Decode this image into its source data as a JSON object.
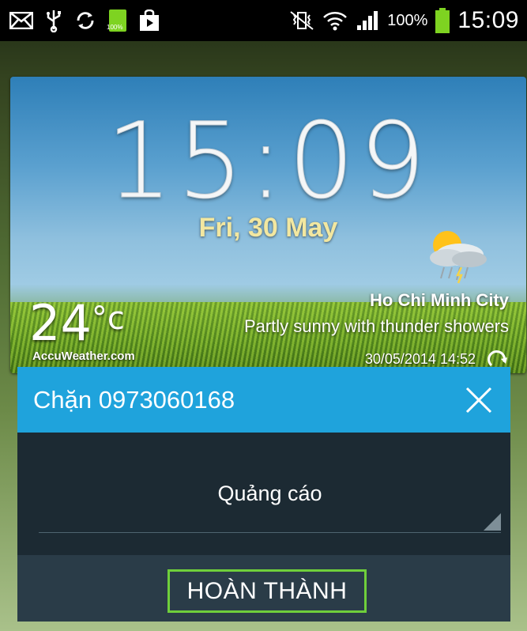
{
  "status_bar": {
    "icons_left": [
      "mail-icon",
      "usb-icon",
      "sync-icon",
      "battery-charging-icon",
      "shopping-bag-icon"
    ],
    "mini_battery_label": "100%",
    "icons_right": [
      "vibrate-mute-icon",
      "wifi-icon",
      "signal-icon",
      "battery-icon"
    ],
    "battery_percent": "100%",
    "time": "15:09"
  },
  "widget": {
    "clock": "15:09",
    "date": "Fri, 30 May",
    "temperature": "24",
    "temperature_unit": "°c",
    "brand": "AccuWeather.com",
    "city": "Ho Chi Minh City",
    "condition": "Partly sunny with thunder showers",
    "updated": "30/05/2014 14:52",
    "weather_icon": "partly-sunny-thunder-icon"
  },
  "dialog": {
    "title": "Chặn 0973060168",
    "selected_option": "Quảng cáo",
    "done_label": "HOÀN THÀNH"
  },
  "colors": {
    "header_blue": "#1fa3dc",
    "dialog_body": "#1c2a33",
    "dialog_footer": "#2a3c48",
    "highlight_green": "#6fcf3b"
  }
}
